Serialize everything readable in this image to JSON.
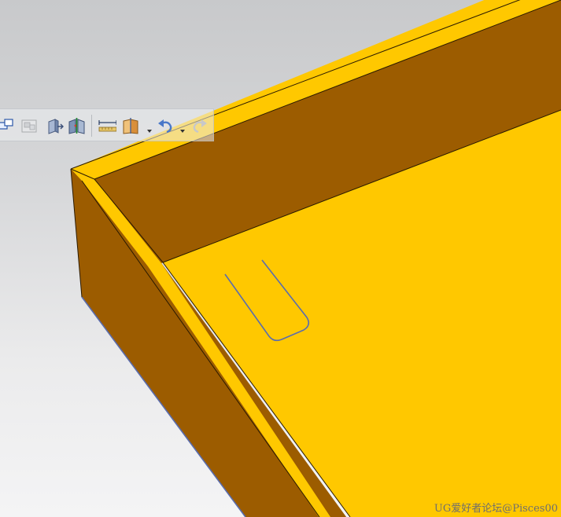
{
  "viewport": {
    "background_top": "#c8c9cb",
    "background_bottom": "#f4f4f5"
  },
  "model": {
    "top_face_color": "#ffc800",
    "side_face_color": "#9c5c00",
    "edge_color": "#2a1a00",
    "sketch_color": "#5a6cae"
  },
  "toolbar": {
    "buttons": [
      {
        "icon": "layer-windows-icon",
        "enabled": true
      },
      {
        "icon": "sheet-view-icon",
        "enabled": false
      },
      {
        "icon": "extrude-face-icon",
        "enabled": true
      },
      {
        "icon": "mirror-body-icon",
        "enabled": true
      },
      {
        "icon": "measure-distance-icon",
        "enabled": true
      },
      {
        "icon": "section-view-icon",
        "enabled": true,
        "has_dropdown": true
      },
      {
        "icon": "undo-icon",
        "enabled": true,
        "has_dropdown": true
      },
      {
        "icon": "redo-icon",
        "enabled": false
      }
    ]
  },
  "watermark": {
    "text": "UG爱好者论坛@Pisces00"
  }
}
